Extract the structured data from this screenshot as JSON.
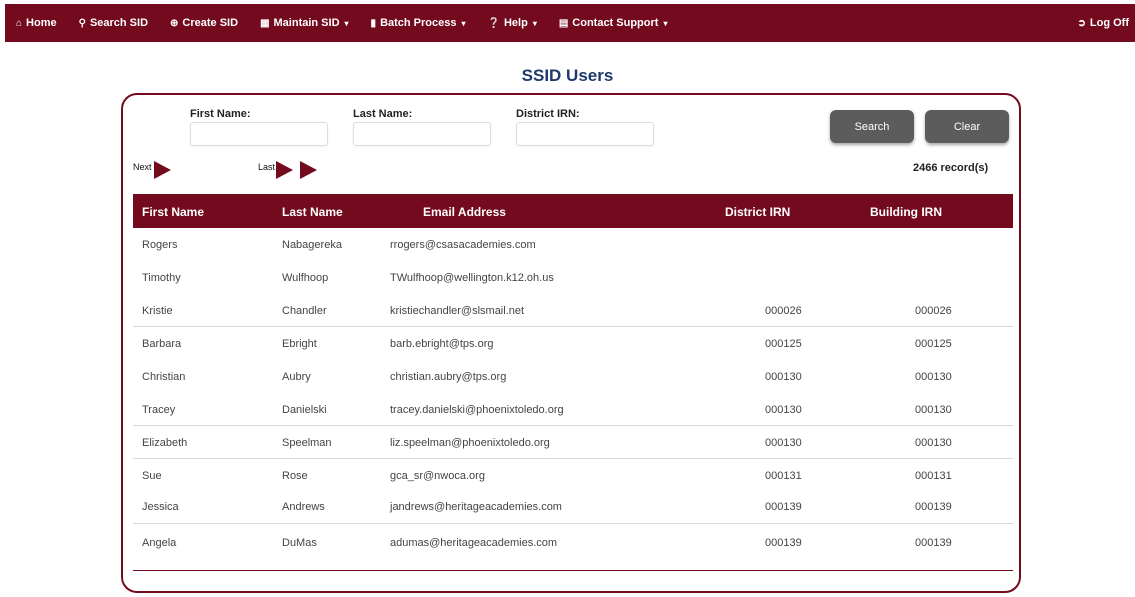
{
  "nav": {
    "home": "Home",
    "search_sid": "Search SID",
    "create_sid": "Create SID",
    "maintain_sid": "Maintain SID",
    "batch_process": "Batch Process",
    "help": "Help",
    "contact_support": "Contact Support",
    "log_off": "Log Off"
  },
  "page": {
    "title": "SSID Users"
  },
  "filters": {
    "first_name_label": "First Name:",
    "last_name_label": "Last Name:",
    "district_irn_label": "District IRN:",
    "first_name_value": "",
    "last_name_value": "",
    "district_irn_value": ""
  },
  "buttons": {
    "search": "Search",
    "clear": "Clear"
  },
  "pager": {
    "next": "Next",
    "last": "Last",
    "records": "2466 record(s)"
  },
  "table": {
    "headers": [
      "First Name",
      "Last Name",
      "Email Address",
      "District IRN",
      "Building IRN"
    ],
    "rows": [
      [
        "Rogers",
        "Nabagereka",
        "rrogers@csasacademies.com",
        "",
        ""
      ],
      [
        "Timothy",
        "Wulfhoop",
        "TWulfhoop@wellington.k12.oh.us",
        "",
        ""
      ],
      [
        "Kristie",
        "Chandler",
        "kristiechandler@slsmail.net",
        "000026",
        "000026"
      ],
      [
        "Barbara",
        "Ebright",
        "barb.ebright@tps.org",
        "000125",
        "000125"
      ],
      [
        "Christian",
        "Aubry",
        "christian.aubry@tps.org",
        "000130",
        "000130"
      ],
      [
        "Tracey",
        "Danielski",
        "tracey.danielski@phoenixtoledo.org",
        "000130",
        "000130"
      ],
      [
        "Elizabeth",
        "Speelman",
        "liz.speelman@phoenixtoledo.org",
        "000130",
        "000130"
      ],
      [
        "Sue",
        "Rose",
        "gca_sr@nwoca.org",
        "000131",
        "000131"
      ],
      [
        "Jessica",
        "Andrews",
        "jandrews@heritageacademies.com",
        "000139",
        "000139"
      ],
      [
        "Angela",
        "DuMas",
        "adumas@heritageacademies.com",
        "000139",
        "000139"
      ]
    ]
  },
  "colors": {
    "brand": "#730a1e",
    "title": "#1f3a6b",
    "button": "#5c5c5c"
  }
}
